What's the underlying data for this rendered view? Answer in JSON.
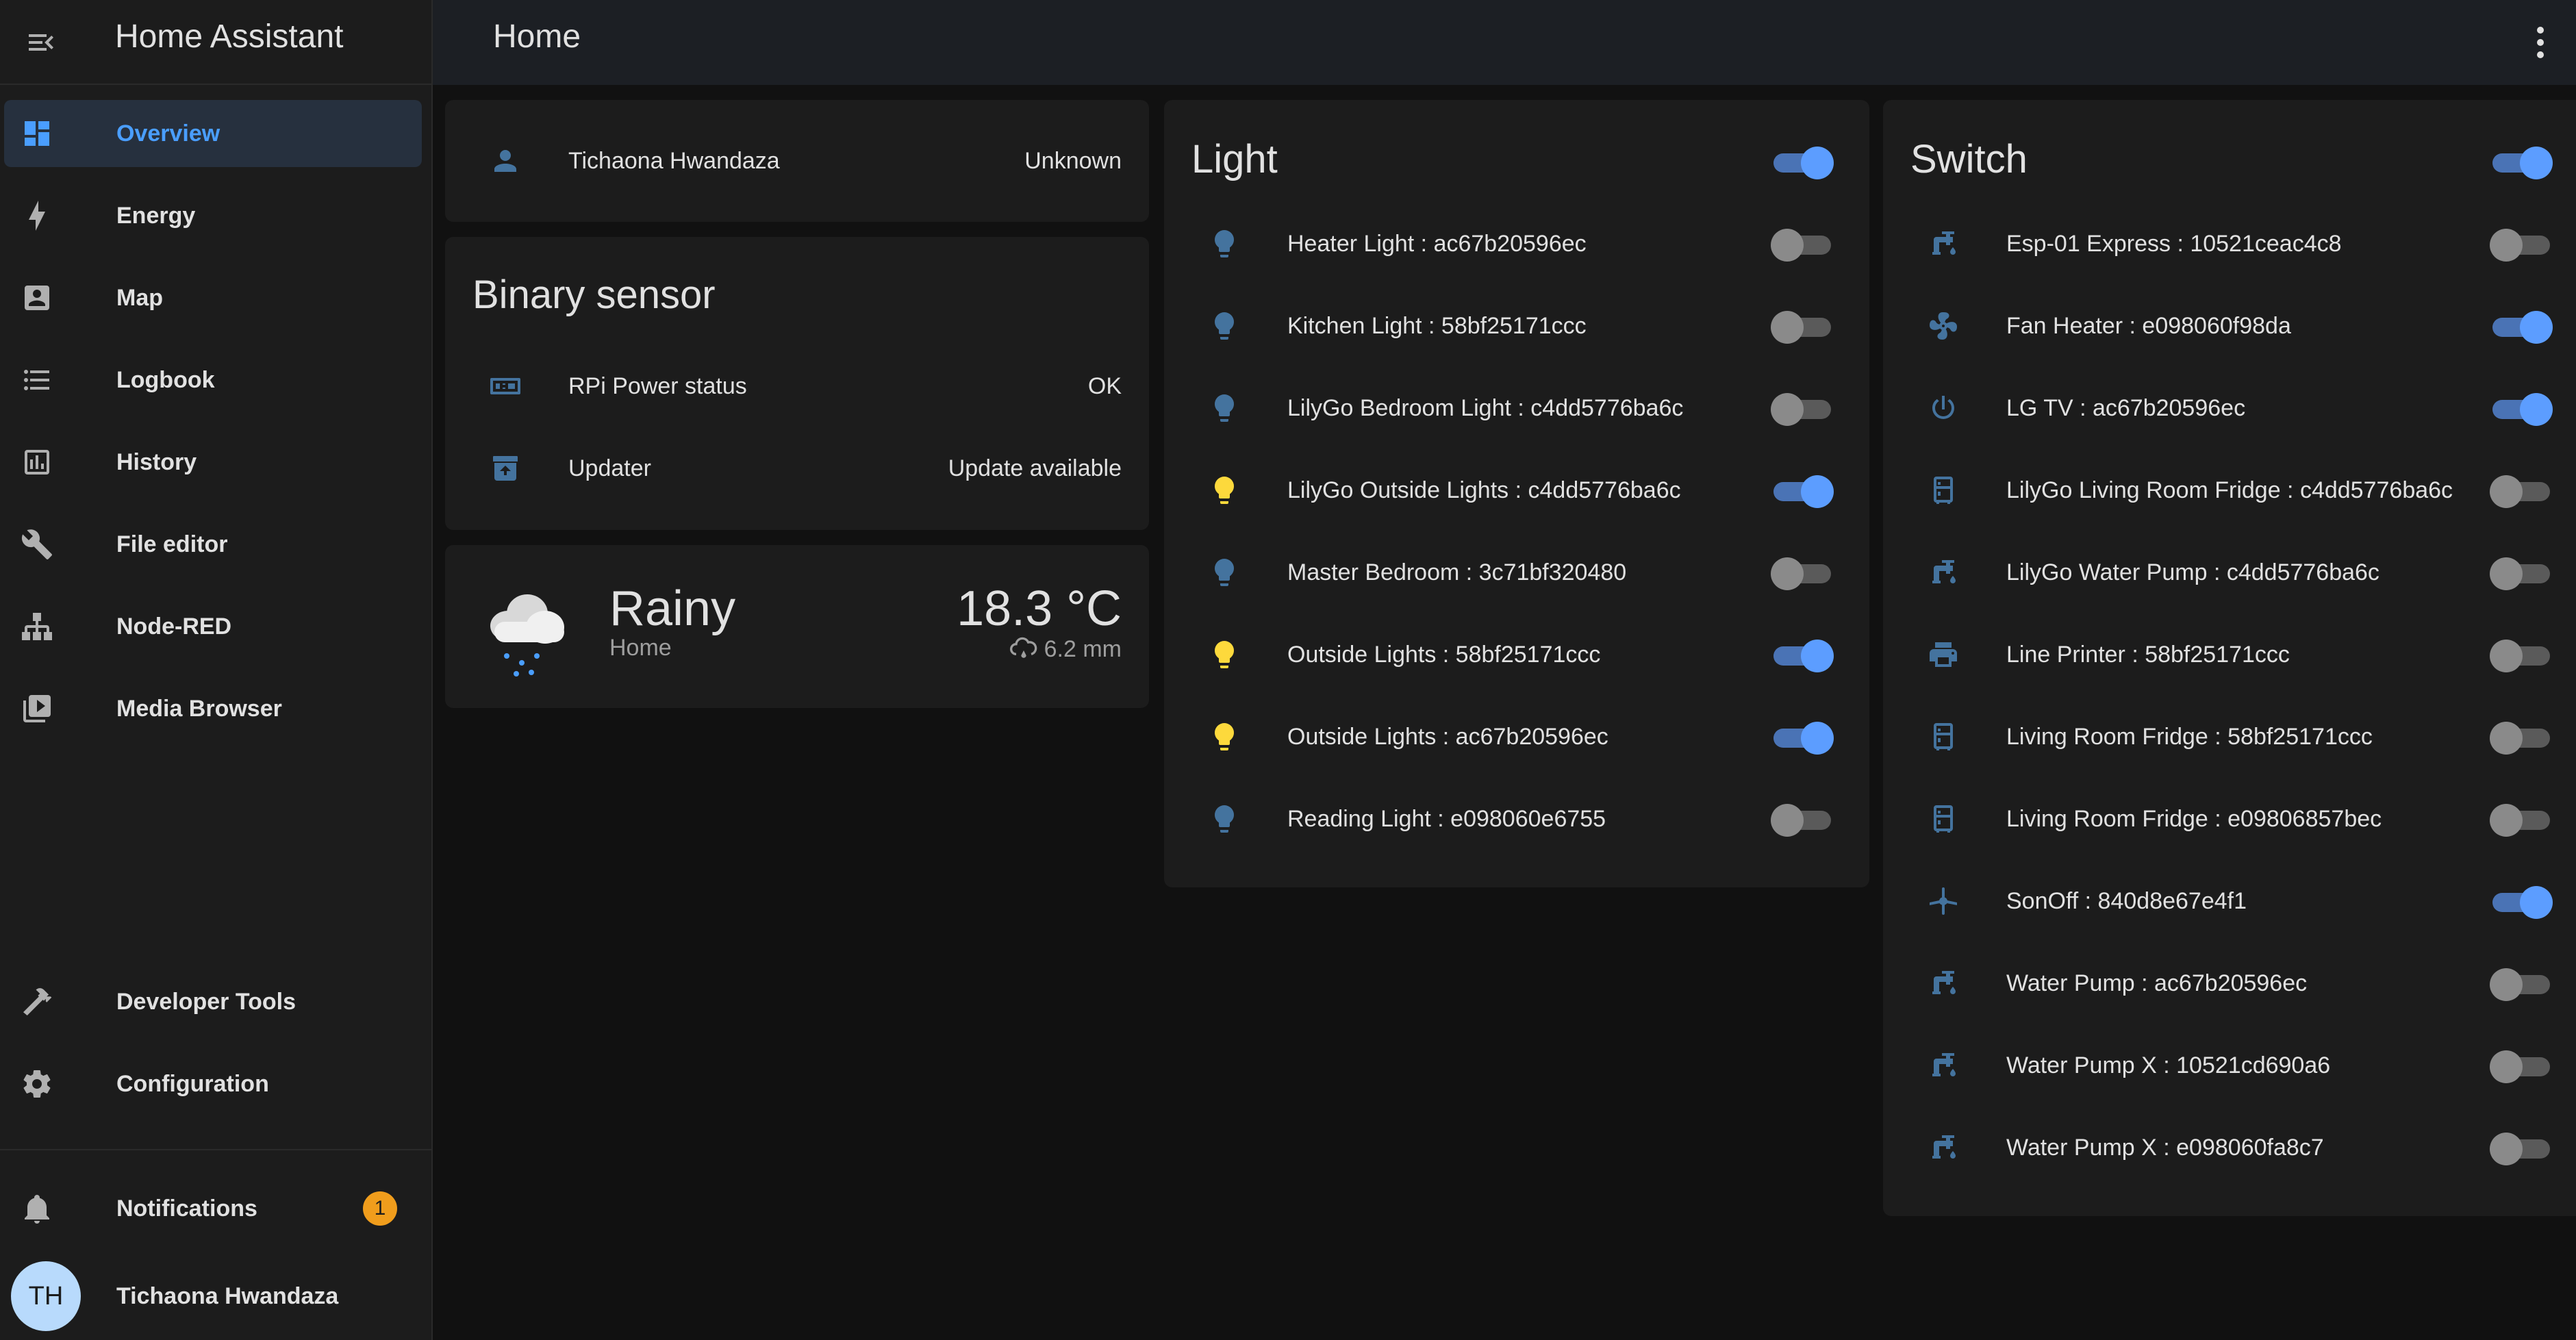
{
  "sidebar": {
    "title": "Home Assistant",
    "items": [
      {
        "label": "Overview",
        "icon": "view-dashboard-icon"
      },
      {
        "label": "Energy",
        "icon": "lightning-bolt-icon"
      },
      {
        "label": "Map",
        "icon": "account-box-icon"
      },
      {
        "label": "Logbook",
        "icon": "format-list-bulleted-icon"
      },
      {
        "label": "History",
        "icon": "chart-box-icon"
      },
      {
        "label": "File editor",
        "icon": "wrench-icon"
      },
      {
        "label": "Node-RED",
        "icon": "sitemap-icon"
      },
      {
        "label": "Media Browser",
        "icon": "play-box-multiple-icon"
      }
    ],
    "bottom_items": [
      {
        "label": "Developer Tools",
        "icon": "hammer-icon"
      },
      {
        "label": "Configuration",
        "icon": "cog-icon"
      }
    ],
    "notifications": {
      "label": "Notifications",
      "count": "1"
    },
    "user": {
      "initials": "TH",
      "name": "Tichaona Hwandaza"
    }
  },
  "header": {
    "title": "Home"
  },
  "person_card": {
    "name": "Tichaona Hwandaza",
    "state": "Unknown"
  },
  "binary_sensor": {
    "title": "Binary sensor",
    "rows": [
      {
        "name": "RPi Power status",
        "state": "OK"
      },
      {
        "name": "Updater",
        "state": "Update available"
      }
    ]
  },
  "weather": {
    "condition": "Rainy",
    "location": "Home",
    "temperature": "18.3 °C",
    "precipitation": "6.2 mm"
  },
  "light_card": {
    "title": "Light",
    "header_toggle_on": true,
    "rows": [
      {
        "name": "Heater Light : ac67b20596ec",
        "on": false
      },
      {
        "name": "Kitchen Light : 58bf25171ccc",
        "on": false
      },
      {
        "name": "LilyGo Bedroom Light : c4dd5776ba6c",
        "on": false
      },
      {
        "name": "LilyGo Outside Lights : c4dd5776ba6c",
        "on": true
      },
      {
        "name": "Master Bedroom : 3c71bf320480",
        "on": false
      },
      {
        "name": "Outside Lights : 58bf25171ccc",
        "on": true
      },
      {
        "name": "Outside Lights : ac67b20596ec",
        "on": true
      },
      {
        "name": "Reading Light : e098060e6755",
        "on": false
      }
    ]
  },
  "switch_card": {
    "title": "Switch",
    "header_toggle_on": true,
    "rows": [
      {
        "name": "Esp-01 Express : 10521ceac4c8",
        "icon": "water-pump-icon",
        "on": false
      },
      {
        "name": "Fan Heater : e098060f98da",
        "icon": "fan-icon",
        "on": true
      },
      {
        "name": "LG TV : ac67b20596ec",
        "icon": "power-icon",
        "on": true
      },
      {
        "name": "LilyGo Living Room Fridge : c4dd5776ba6c",
        "icon": "fridge-icon",
        "on": false
      },
      {
        "name": "LilyGo Water Pump : c4dd5776ba6c",
        "icon": "water-pump-icon",
        "on": false
      },
      {
        "name": "Line Printer : 58bf25171ccc",
        "icon": "printer-icon",
        "on": false
      },
      {
        "name": "Living Room Fridge : 58bf25171ccc",
        "icon": "fridge-icon",
        "on": false
      },
      {
        "name": "Living Room Fridge : e09806857bec",
        "icon": "fridge-icon",
        "on": false
      },
      {
        "name": "SonOff : 840d8e67e4f1",
        "icon": "ceiling-fan-icon",
        "on": true
      },
      {
        "name": "Water Pump : ac67b20596ec",
        "icon": "water-pump-icon",
        "on": false
      },
      {
        "name": "Water Pump X : 10521cd690a6",
        "icon": "water-pump-icon",
        "on": false
      },
      {
        "name": "Water Pump X : e098060fa8c7",
        "icon": "water-pump-icon",
        "on": false
      }
    ]
  },
  "colors": {
    "accent": "#5c9dff",
    "icon": "#44739e",
    "light_on": "#fdd93c",
    "badge": "#f09d1c"
  }
}
